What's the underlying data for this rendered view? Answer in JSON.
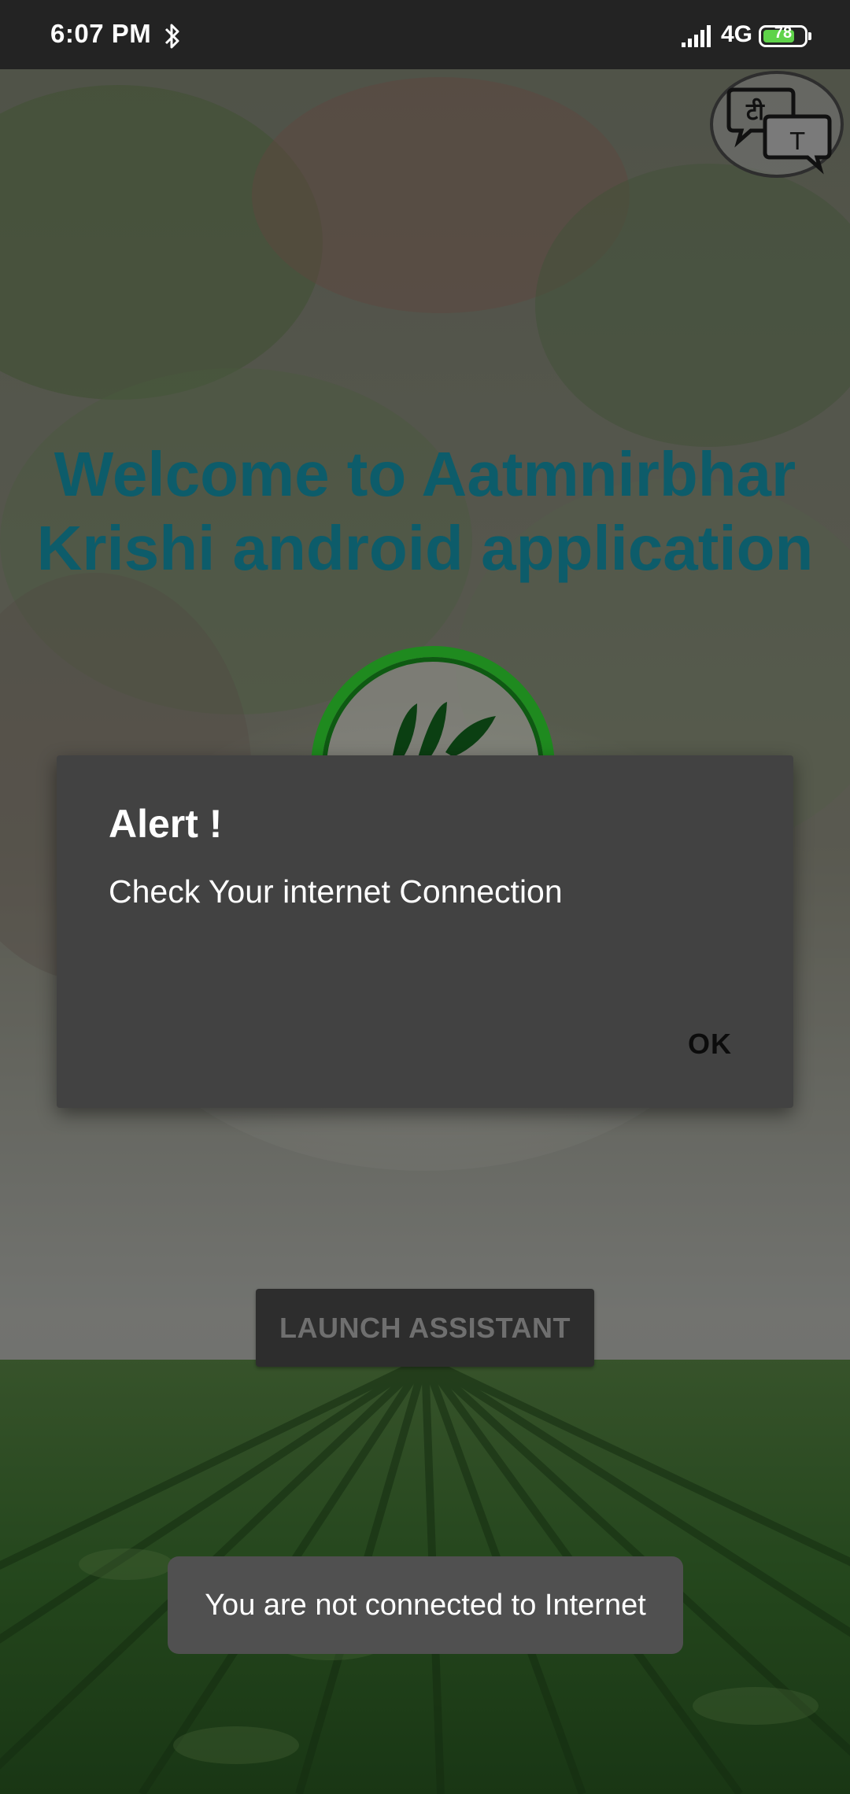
{
  "status_bar": {
    "time": "6:07 PM",
    "network_type": "4G",
    "battery_level": "78",
    "battery_fraction": 0.78,
    "icons": [
      "bluetooth-icon",
      "signal-icon",
      "battery-icon"
    ]
  },
  "translate_button": {
    "icon": "translate-icon",
    "source_glyph": "टी",
    "target_glyph": "T"
  },
  "welcome": {
    "title": "Welcome to Aatmnirbhar Krishi android application"
  },
  "logo": {
    "icon": "leaf-logo-icon"
  },
  "launch_assistant": {
    "label": "LAUNCH ASSISTANT"
  },
  "alert": {
    "title": "Alert !",
    "message": "Check Your internet Connection",
    "ok_label": "OK"
  },
  "toast": {
    "message": "You are not connected to Internet"
  },
  "colors": {
    "title": "#0d5c6a",
    "dialog_bg": "#424242",
    "status_bar_bg": "#232323",
    "battery_fill": "#5fd34a",
    "logo_ring": "#1f8a1f"
  }
}
